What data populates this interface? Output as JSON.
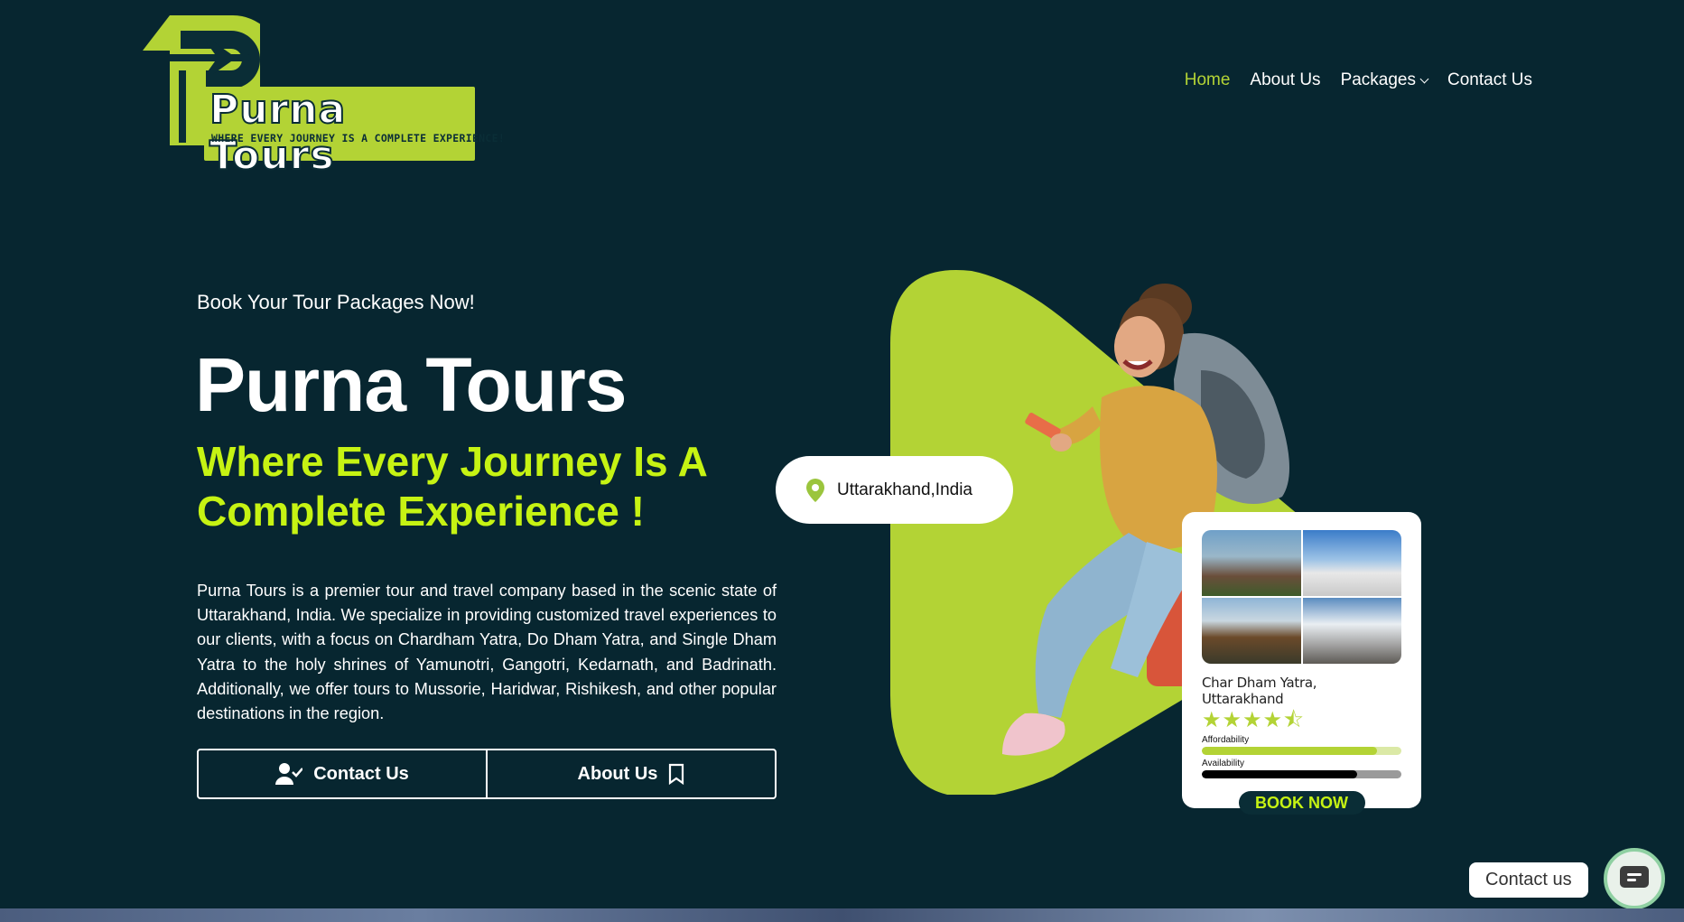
{
  "brand": {
    "name": "Purna Tours",
    "tagline": "WHERE EVERY JOURNEY IS A COMPLETE EXPERIENCE!",
    "accent_color": "#b3d335",
    "highlight_color": "#c6f313",
    "background_color": "#072630"
  },
  "nav": {
    "items": [
      {
        "label": "Home",
        "active": true
      },
      {
        "label": "About Us",
        "active": false
      },
      {
        "label": "Packages",
        "active": false,
        "has_dropdown": true
      },
      {
        "label": "Contact Us",
        "active": false
      }
    ]
  },
  "hero": {
    "eyebrow": "Book Your Tour Packages Now!",
    "title": "Purna Tours",
    "subtitle": "Where Every Journey Is A Complete Experience !",
    "description": "Purna Tours is a premier tour and travel company based in the scenic state of Uttarakhand, India. We specialize in providing customized travel experiences to our clients, with a focus on Chardham Yatra, Do Dham Yatra, and Single Dham Yatra to the holy shrines of Yamunotri, Gangotri, Kedarnath, and Badrinath. Additionally, we offer tours to Mussorie, Haridwar, Rishikesh, and other popular destinations in the region.",
    "buttons": {
      "contact": {
        "label": "Contact Us",
        "icon": "user-check-icon"
      },
      "about": {
        "label": "About Us",
        "icon": "bookmark-icon"
      }
    }
  },
  "location_pill": {
    "text": "Uttarakhand,India",
    "icon": "map-pin-icon"
  },
  "package_card": {
    "title": "Char Dham Yatra, Uttarakhand",
    "rating": 4.5,
    "stars": "★★★★⯪",
    "bars": [
      {
        "label": "Affordability",
        "value": 0.88
      },
      {
        "label": "Availability",
        "value": 0.78
      }
    ],
    "cta": "BOOK NOW"
  },
  "contact_widget": {
    "label": "Contact us",
    "icon": "chat-icon"
  }
}
